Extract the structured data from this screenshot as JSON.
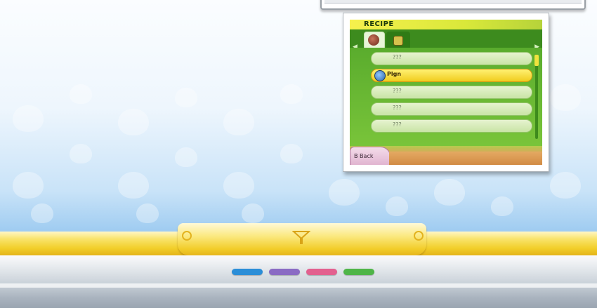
{
  "recipe_screen": {
    "title": "RECIPE",
    "rows": [
      {
        "label": "???",
        "selected": false,
        "icon": null
      },
      {
        "label": "Plgn",
        "selected": true,
        "icon": "character-icon"
      },
      {
        "label": "???",
        "selected": false,
        "icon": null
      },
      {
        "label": "???",
        "selected": false,
        "icon": null
      },
      {
        "label": "???",
        "selected": false,
        "icon": null
      }
    ],
    "back_button": {
      "key": "B",
      "label": "Back"
    }
  },
  "colors": {
    "dot_blue": "#2b8ed8",
    "dot_purple": "#8a6bc4",
    "dot_pink": "#e3608f",
    "dot_green": "#4fb548",
    "gold": "#f2cf2a"
  }
}
